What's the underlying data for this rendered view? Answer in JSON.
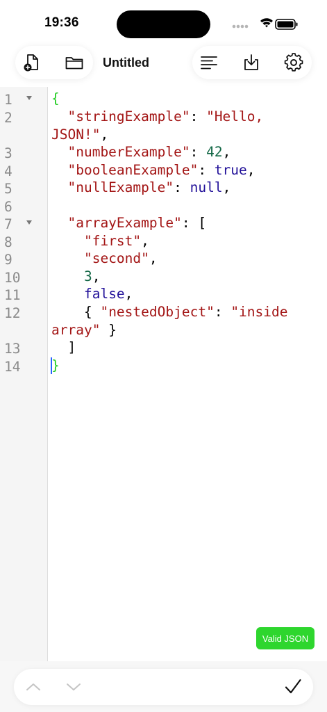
{
  "status": {
    "time": "19:36"
  },
  "toolbar": {
    "title": "Untitled",
    "icons": [
      "new-document-icon",
      "folder-icon",
      "format-icon",
      "download-icon",
      "gear-icon"
    ]
  },
  "editor": {
    "line_numbers": [
      "1",
      "2",
      "3",
      "4",
      "5",
      "6",
      "7",
      "8",
      "9",
      "10",
      "11",
      "12",
      "13",
      "14"
    ],
    "fold_lines": [
      "1",
      "7"
    ],
    "tokens": {
      "open_brace": "{",
      "string_example_key": "\"stringExample\"",
      "colon_space": ": ",
      "hello_part1": "\"Hello,",
      "hello_part2": "JSON!\"",
      "comma": ",",
      "number_example_key": "\"numberExample\"",
      "number_value": "42",
      "boolean_example_key": "\"booleanExample\"",
      "boolean_value": "true",
      "null_example_key": "\"nullExample\"",
      "null_value": "null",
      "array_example_key": "\"arrayExample\"",
      "open_bracket": "[",
      "first": "\"first\"",
      "second": "\"second\"",
      "three": "3",
      "false_value": "false",
      "nested_open": "{ ",
      "nested_key": "\"nestedObject\"",
      "inside_part1": "\"inside",
      "inside_part2": "array\"",
      "nested_close": " }",
      "close_bracket": "]",
      "close_brace": "}"
    }
  },
  "validation": {
    "label": "Valid JSON",
    "color": "#2ed62e"
  },
  "bottom_bar": {
    "icons": [
      "chevron-up-icon",
      "chevron-down-icon",
      "checkmark-icon"
    ]
  },
  "colors": {
    "key_string": "#a31515",
    "number": "#116644",
    "atom": "#221199",
    "matched_brace": "#22cc22"
  }
}
